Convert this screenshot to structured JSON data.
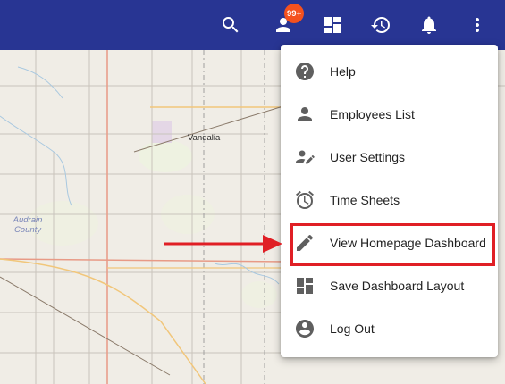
{
  "map": {
    "town_label": "Vandalia",
    "county_label_line1": "Audrain",
    "county_label_line2": "County"
  },
  "topbar": {
    "color": "#283593",
    "notifications_badge": "99+",
    "icons": [
      "search-icon",
      "person-icon",
      "dashboard-icon",
      "history-icon",
      "bell-icon",
      "more-vert-icon"
    ]
  },
  "menu": {
    "items": [
      {
        "label": "Help",
        "icon": "help-icon"
      },
      {
        "label": "Employees List",
        "icon": "person-icon"
      },
      {
        "label": "User Settings",
        "icon": "user-edit-icon"
      },
      {
        "label": "Time Sheets",
        "icon": "alarm-icon"
      },
      {
        "label": "View Homepage Dashboard",
        "icon": "pencil-icon"
      },
      {
        "label": "Save Dashboard Layout",
        "icon": "dashboard-icon"
      },
      {
        "label": "Log Out",
        "icon": "account-circle-icon"
      }
    ]
  },
  "annotation": {
    "highlight_color": "#e01f25"
  }
}
